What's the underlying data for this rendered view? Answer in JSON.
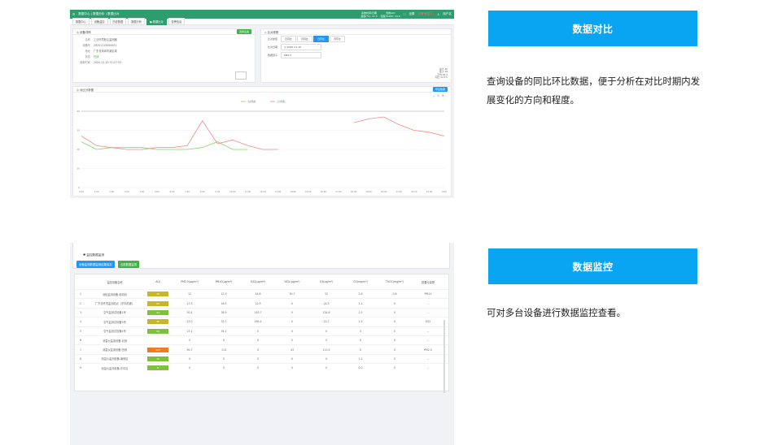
{
  "app1": {
    "topbar": {
      "menu_icon": "menu-icon",
      "breadcrumb": "数据中心 | 数据分析 | 数据比对",
      "info1_line1": "系统时间/日期",
      "info1_line2": "温度(℃): 11.5",
      "info2_line1": "当前AQI",
      "info2_line2": "湿度(%RH): 24.6",
      "fullscreen_label": "全屏",
      "alert_label": "告警消息(1)",
      "user_label": "用户名"
    },
    "tabs": [
      {
        "label": "数据中心",
        "active": false
      },
      {
        "label": "设备监控",
        "active": false
      },
      {
        "label": "历史数据",
        "active": false
      },
      {
        "label": "数据分析",
        "active": false
      },
      {
        "label": "● 数据比对",
        "active": true
      },
      {
        "label": "告警信息",
        "active": false
      }
    ],
    "device_panel": {
      "title": "◎ 设备详情",
      "select_button": "选择设备",
      "fields": [
        {
          "key": "名称",
          "value": "工业环境粉尘监测器"
        },
        {
          "key": "设备号",
          "value": "20201115000001"
        },
        {
          "key": "地址",
          "value": "广东省深圳市某区域"
        },
        {
          "key": "状态",
          "value": "在线",
          "ok": true
        },
        {
          "key": "最新时间",
          "value": "2020-11-10 11:27:33"
        }
      ]
    },
    "compare_panel": {
      "title": "◇ 比对参数",
      "type_label": "比对类型",
      "type_options": [
        {
          "label": "日同比",
          "active": false
        },
        {
          "label": "月同比",
          "active": false
        },
        {
          "label": "日环比",
          "active": true
        },
        {
          "label": "月环比",
          "active": false
        }
      ],
      "date_label": "比对日期",
      "date_value": "◷ 2020-11-10",
      "factor_label": "数据因子",
      "factor_value": "PM2.5",
      "stats": [
        {
          "label": "最大",
          "value": "46"
        },
        {
          "label": "最小",
          "value": "18"
        },
        {
          "label": "平均",
          "value": "29.4"
        },
        {
          "label": "同比",
          "value": "12.5%"
        }
      ]
    },
    "chart_panel": {
      "title": "◎ 对比分析图",
      "export_button": "导出数据",
      "toolbar_icons": [
        "download-icon",
        "refresh-icon",
        "zoom-icon"
      ]
    }
  },
  "chart_data": {
    "type": "line",
    "legend": [
      "当前数据",
      "对比数据"
    ],
    "legend_position": "top-center",
    "ylim": [
      0,
      40
    ],
    "y_ticks": [
      "40",
      "30",
      "20",
      "10",
      "0"
    ],
    "categories": [
      "0:00",
      "1:00",
      "2:00",
      "3:00",
      "4:00",
      "5:00",
      "6:00",
      "7:00",
      "8:00",
      "9:00",
      "10:00",
      "11:00",
      "12:00",
      "13:00",
      "14:00",
      "15:00",
      "16:00",
      "17:00",
      "18:00",
      "19:00",
      "20:00",
      "21:00",
      "22:00",
      "23:00",
      "0:00"
    ],
    "grid": true,
    "series": [
      {
        "name": "当前数据",
        "color": "#8bd36a",
        "values": [
          24,
          20,
          21,
          21,
          21,
          20,
          20,
          20,
          21,
          24,
          20,
          20,
          null,
          null,
          null,
          null,
          null,
          null,
          null,
          null,
          null,
          null,
          null,
          null,
          null
        ]
      },
      {
        "name": "对比数据",
        "color": "#f08a8a",
        "values": [
          27,
          22,
          21,
          20,
          20,
          21,
          21,
          22,
          35,
          23,
          25,
          22,
          20,
          20,
          null,
          null,
          null,
          null,
          34,
          36,
          37,
          33,
          30,
          29,
          27
        ]
      }
    ]
  },
  "app2": {
    "list_title": "♥ 监控数据监测",
    "buttons": [
      {
        "label": "设备监测数据监测结果保存",
        "style": "blue"
      },
      {
        "label": "当前数据监测",
        "style": "green"
      }
    ],
    "columns": [
      "",
      "监控设备名称",
      "AQI",
      "PM2.5(μg/m³)",
      "PM10(μg/m³)",
      "SO2(μg/m³)",
      "NO2(μg/m³)",
      "O3(μg/m³)",
      "CO(mg/m³)",
      "TVOC(mg/m³)",
      "首要污染物"
    ],
    "rows": [
      {
        "idx": "1",
        "name": "测绘监测设备-电动机",
        "aqi": "40",
        "aqi_color": "#c8b52a",
        "pm25": "12",
        "pm10": "12.5",
        "so2": "44.6",
        "no2": "30.7",
        "o3": "32",
        "co": "2.6",
        "tvoc": "0.6",
        "primary": "PM10"
      },
      {
        "idx": "2",
        "name": "广东省环境监测站点（东华前通）",
        "aqi": "50",
        "aqi_color": "#c8b52a",
        "pm25": "17.5",
        "pm10": "16.5",
        "so2": "22.3",
        "no2": "0",
        "o3": "24.3",
        "co": "1.2",
        "tvoc": "0",
        "primary": "--"
      },
      {
        "idx": "3",
        "name": "空气监测试设备1号",
        "aqi": "34",
        "aqi_color": "#7ec13a",
        "pm25": "30.4",
        "pm10": "36.9",
        "so2": "163.7",
        "no2": "0",
        "o3": "134.6",
        "co": "1.5",
        "tvoc": "0",
        "primary": "--"
      },
      {
        "idx": "4",
        "name": "空气监测试设备3号",
        "aqi": "40",
        "aqi_color": "#c8b52a",
        "pm25": "23.0",
        "pm10": "32.1",
        "so2": "165.4",
        "no2": "0",
        "o3": "22.7",
        "co": "1.5",
        "tvoc": "0",
        "primary": "SO2"
      },
      {
        "idx": "5",
        "name": "空气监测试设备4号",
        "aqi": "30",
        "aqi_color": "#7ec13a",
        "pm25": "23.1",
        "pm10": "34.1",
        "so2": "0",
        "no2": "0",
        "o3": "0",
        "co": "0",
        "tvoc": "0",
        "primary": "--"
      },
      {
        "idx": "6",
        "name": "测温仪监测设备-北侧",
        "aqi": "",
        "aqi_color": "",
        "pm25": "0",
        "pm10": "0",
        "so2": "0",
        "no2": "0",
        "o3": "0",
        "co": "0",
        "tvoc": "0",
        "primary": "--"
      },
      {
        "idx": "7",
        "name": "测温仪监测设备-西侧",
        "aqi": "117",
        "aqi_color": "#f07a26",
        "pm25": "90.7",
        "pm10": "114",
        "so2": "0",
        "no2": "43",
        "o3": "113.5",
        "co": "0",
        "tvoc": "0",
        "primary": "PM2.5"
      },
      {
        "idx": "8",
        "name": "测温仪监测设备-南侧区",
        "aqi": "10",
        "aqi_color": "#7ec13a",
        "pm25": "0",
        "pm10": "0",
        "so2": "0",
        "no2": "0",
        "o3": "0",
        "co": "1.2",
        "tvoc": "0",
        "primary": "--"
      },
      {
        "idx": "9",
        "name": "测温仪监测设备-东中区",
        "aqi": "8",
        "aqi_color": "#7ec13a",
        "pm25": "0",
        "pm10": "0",
        "so2": "0",
        "no2": "0",
        "o3": "0",
        "co": "0.0",
        "tvoc": "0",
        "primary": "--"
      }
    ]
  },
  "features": [
    {
      "title": "数据对比",
      "desc": "查询设备的同比环比数据，便于分析在对比时期内发展变化的方向和程度。"
    },
    {
      "title": "数据监控",
      "desc": "可对多台设备进行数据监控查看。"
    }
  ]
}
